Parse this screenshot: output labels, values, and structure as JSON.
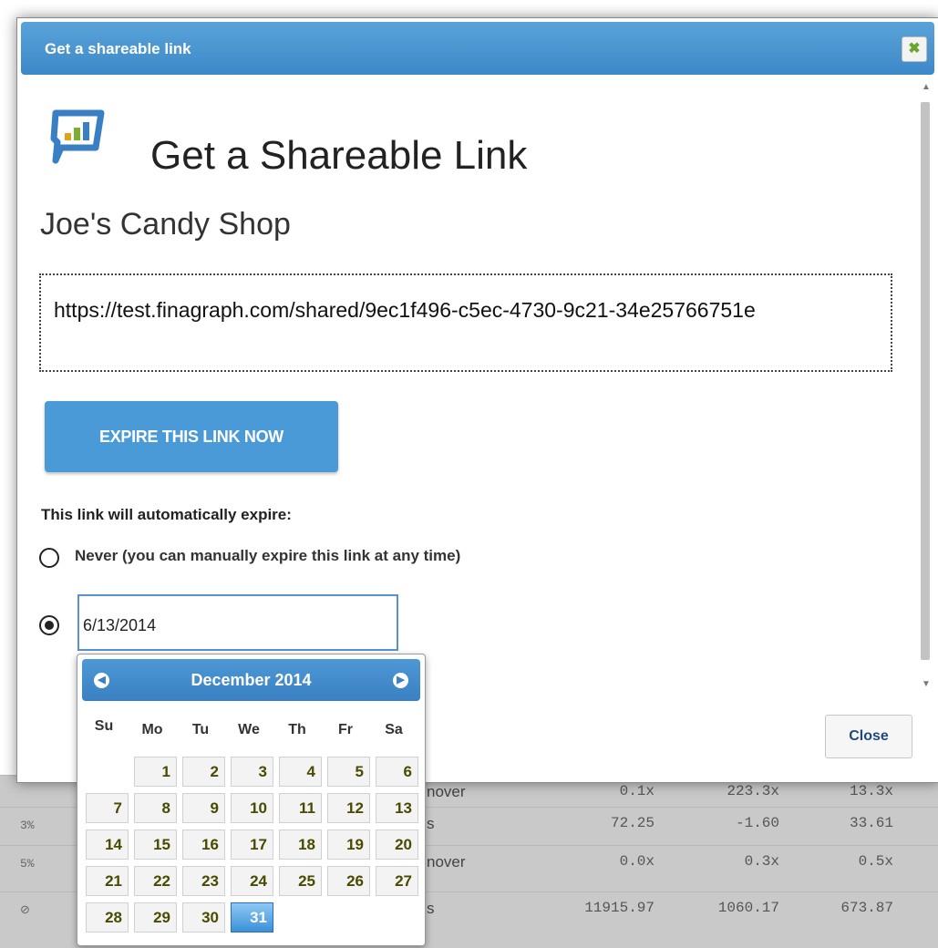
{
  "dialog": {
    "title": "Get a shareable link",
    "close_x": "✖",
    "heading": "Get a Shareable Link",
    "shop_name": "Joe's Candy Shop",
    "url": "https://test.finagraph.com/shared/9ec1f496-c5ec-4730-9c21-34e25766751e",
    "expire_button": "EXPIRE THIS LINK NOW",
    "expire_label": "This link will automatically expire:",
    "never_option": "Never (you can manually expire this link at any time)",
    "date_value": "6/13/2014",
    "selected_option": "date",
    "close_button": "Close"
  },
  "calendar": {
    "month_label": "December 2014",
    "weekdays": [
      "Su",
      "Mo",
      "Tu",
      "We",
      "Th",
      "Fr",
      "Sa"
    ],
    "days": [
      [
        "",
        "1",
        "2",
        "3",
        "4",
        "5",
        "6"
      ],
      [
        "7",
        "8",
        "9",
        "10",
        "11",
        "12",
        "13"
      ],
      [
        "14",
        "15",
        "16",
        "17",
        "18",
        "19",
        "20"
      ],
      [
        "21",
        "22",
        "23",
        "24",
        "25",
        "26",
        "27"
      ],
      [
        "28",
        "29",
        "30",
        "31",
        "",
        "",
        ""
      ]
    ],
    "selected_day": "31"
  },
  "background_table": {
    "rows": [
      {
        "left": "",
        "label": "nover",
        "v1": "0.1x",
        "v2": "223.3x",
        "v3": "13.3x"
      },
      {
        "left": "3%",
        "label": "s",
        "v1": "72.25",
        "v2": "-1.60",
        "v3": "33.61"
      },
      {
        "left": "5%",
        "label": "nover",
        "v1": "0.0x",
        "v2": "0.3x",
        "v3": "0.5x"
      },
      {
        "left": "⊘",
        "label": "s",
        "v1": "11915.97",
        "v2": "1060.17",
        "v3": "673.87"
      }
    ]
  },
  "colors": {
    "titlebar": "#4a96d2",
    "button": "#4a9ad8",
    "logo_blue": "#3a7fc4",
    "selected_day": "#3a90d8"
  }
}
